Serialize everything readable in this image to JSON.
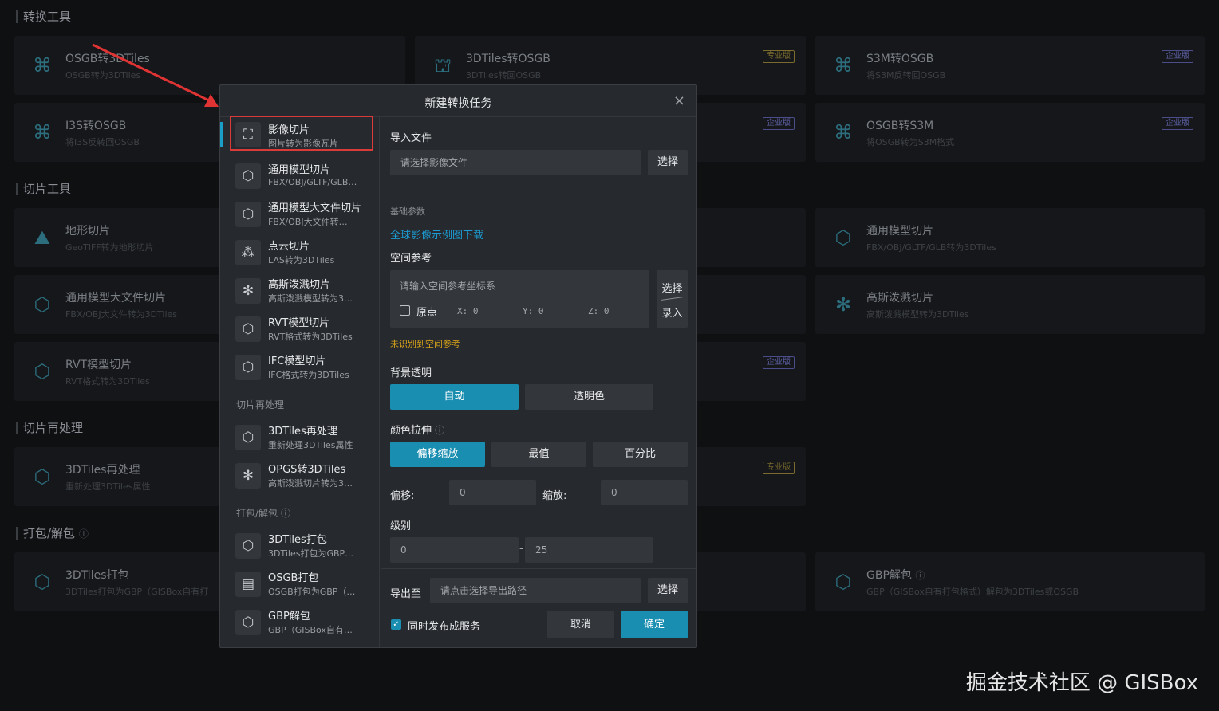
{
  "sections": {
    "convert": "转换工具",
    "slice": "切片工具",
    "reprocess": "切片再处理",
    "pack": "打包/解包"
  },
  "cards": {
    "osgb_3dtiles": {
      "title": "OSGB转3DTiles",
      "sub": "OSGB转为3DTiles"
    },
    "3dtiles_osgb": {
      "title": "3DTiles转OSGB",
      "sub": "3DTiles转回OSGB",
      "tag": "专业版"
    },
    "s3m_osgb": {
      "title": "S3M转OSGB",
      "sub": "将S3M反转回OSGB",
      "tag": "企业版"
    },
    "i3s_osgb": {
      "title": "I3S转OSGB",
      "sub": "将I3S反转回OSGB"
    },
    "mid_tag_1": {
      "tag": "企业版"
    },
    "osgb_s3m": {
      "title": "OSGB转S3M",
      "sub": "将OSGB转为S3M格式",
      "tag": "企业版"
    },
    "terrain": {
      "title": "地形切片",
      "sub": "GeoTIFF转为地形切片"
    },
    "general_model": {
      "title": "通用模型切片",
      "sub": "FBX/OBJ/GLTF/GLB转为3DTiles"
    },
    "large_model": {
      "title": "通用模型大文件切片",
      "sub": "FBX/OBJ大文件转为3DTiles"
    },
    "gaussian": {
      "title": "高斯泼溅切片",
      "sub": "高斯泼溅模型转为3DTiles"
    },
    "rvt": {
      "title": "RVT模型切片",
      "sub": "RVT格式转为3DTiles"
    },
    "mid_tag_2": {
      "tag": "企业版"
    },
    "reprocess": {
      "title": "3DTiles再处理",
      "sub": "重新处理3DTiles属性"
    },
    "mid_tag_3": {
      "tag": "专业版"
    },
    "pack": {
      "title": "3DTiles打包",
      "sub": "3DTiles打包为GBP（GISBox自有打"
    },
    "gbp_unpack": {
      "title": "GBP解包",
      "sub": "GBP（GISBox自有打包格式）解包为3DTiles或OSGB"
    }
  },
  "modal": {
    "title": "新建转换任务",
    "close": "×",
    "menu": [
      {
        "title": "影像切片",
        "sub": "图片转为影像瓦片",
        "icon": "image-slice-icon"
      },
      {
        "title": "通用模型切片",
        "sub": "FBX/OBJ/GLTF/GLB…",
        "icon": "cube-icon"
      },
      {
        "title": "通用模型大文件切片",
        "sub": "FBX/OBJ大文件转…",
        "icon": "cube-icon"
      },
      {
        "title": "点云切片",
        "sub": "LAS转为3DTiles",
        "icon": "point-cloud-icon"
      },
      {
        "title": "高斯泼溅切片",
        "sub": "高斯泼溅模型转为3…",
        "icon": "gaussian-icon"
      },
      {
        "title": "RVT模型切片",
        "sub": "RVT格式转为3DTiles",
        "icon": "cube-icon"
      },
      {
        "title": "IFC模型切片",
        "sub": "IFC格式转为3DTiles",
        "icon": "cube-icon"
      },
      {
        "title": "3DTiles再处理",
        "sub": "重新处理3DTiles属性",
        "icon": "reprocess-icon"
      },
      {
        "title": "OPGS转3DTiles",
        "sub": "高斯泼溅切片转为3…",
        "icon": "gaussian-icon"
      },
      {
        "title": "3DTiles打包",
        "sub": "3DTiles打包为GBP…",
        "icon": "package-icon"
      },
      {
        "title": "OSGB打包",
        "sub": "OSGB打包为GBP（…",
        "icon": "package-icon"
      },
      {
        "title": "GBP解包",
        "sub": "GBP（GISBox自有…",
        "icon": "unpack-icon"
      }
    ],
    "group_reprocess": "切片再处理",
    "group_pack": "打包/解包",
    "import_label": "导入文件",
    "import_placeholder": "请选择影像文件",
    "select_btn": "选择",
    "basic_params": "基础参数",
    "download_link": "全球影像示例图下载",
    "spatial_ref": "空间参考",
    "spatial_placeholder": "请输入空间参考坐标系",
    "origin": "原点",
    "x_label": "X: 0",
    "y_label": "Y: 0",
    "z_label": "Z: 0",
    "select_top": "选择",
    "select_bottom": "录入",
    "warn": "未识别到空间参考",
    "bg_transparent": "背景透明",
    "auto": "自动",
    "transparent_color": "透明色",
    "color_stretch": "颜色拉伸",
    "offset_scale": "偏移缩放",
    "extreme": "最值",
    "percent": "百分比",
    "offset_label": "偏移:",
    "offset_value": "0",
    "scale_label": "缩放:",
    "scale_value": "0",
    "level_label": "级别",
    "level_min": "0",
    "level_sep": "-",
    "level_max": "25",
    "export_label": "导出至",
    "export_placeholder": "请点击选择导出路径",
    "export_select": "选择",
    "publish": "同时发布成服务",
    "cancel": "取消",
    "confirm": "确定"
  },
  "watermark": "掘金技术社区 @ GISBox"
}
